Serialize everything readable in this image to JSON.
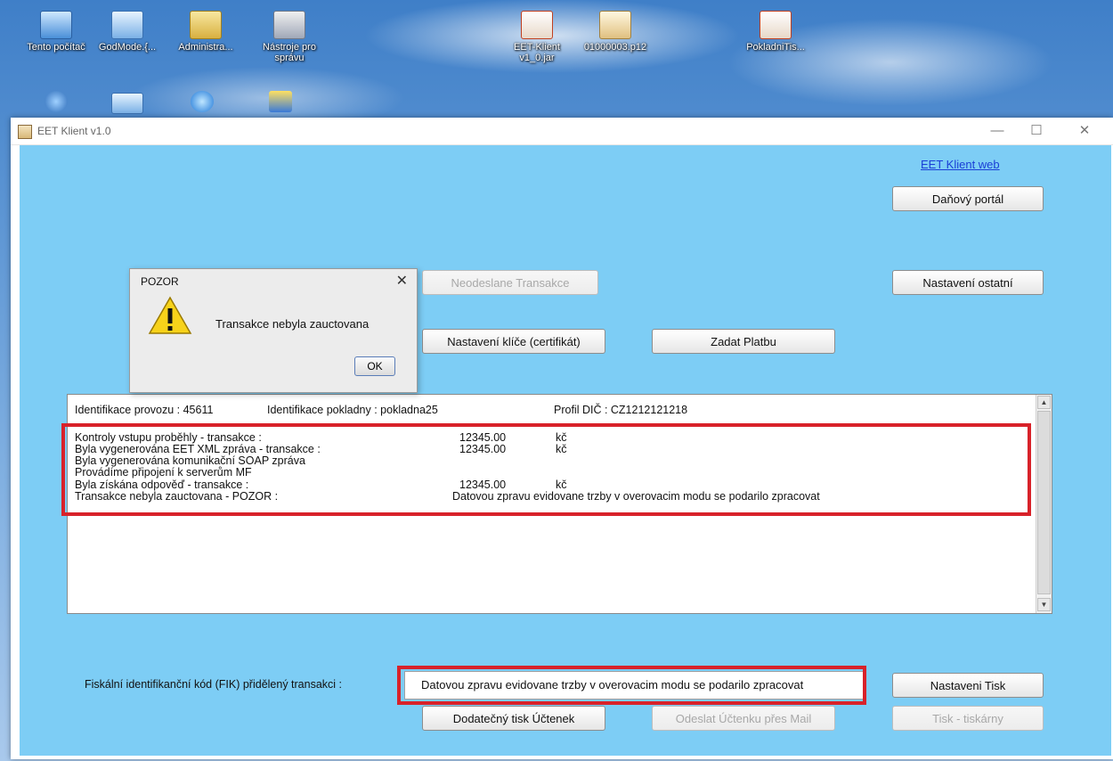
{
  "desktop": {
    "icons": [
      {
        "label": "Tento počítač"
      },
      {
        "label": "GodMode.{..."
      },
      {
        "label": "Administra..."
      },
      {
        "label": "Nástroje pro správu"
      },
      {
        "label": "EET-Klient v1_0.jar"
      },
      {
        "label": "01000003.p12"
      },
      {
        "label": "PokladniTis..."
      }
    ]
  },
  "window": {
    "title": "EET Klient v1.0",
    "minimize": "—",
    "maximize": "☐",
    "close": "✕"
  },
  "top": {
    "web_link": "EET Klient web",
    "danovy_portal": "Daňový portál",
    "nastaveni_ostatni": "Nastavení ostatní"
  },
  "middle": {
    "neodeslane": "Neodeslane Transakce",
    "nastaveni_klice": "Nastavení klíče (certifikát)",
    "zadat_platbu": "Zadat Platbu"
  },
  "log": {
    "header": {
      "provoz": "Identifikace provozu : 45611",
      "pokladna": "Identifikace pokladny : pokladna25",
      "dic": "Profil DIČ : CZ1212121218"
    },
    "rows": [
      {
        "label": "Kontroly vstupu proběhly - transakce :",
        "value": "12345.00",
        "unit": "kč"
      },
      {
        "label": "Byla vygenerována EET XML zpráva - transakce :",
        "value": "12345.00",
        "unit": "kč"
      },
      {
        "label": "Byla vygenerována komunikační SOAP zpráva",
        "value": "",
        "unit": ""
      },
      {
        "label": "Provádíme připojení k serverům MF",
        "value": "",
        "unit": ""
      },
      {
        "label": "Byla získána odpověď - transakce :",
        "value": "12345.00",
        "unit": "kč"
      },
      {
        "label": "Transakce nebyla zauctovana - POZOR :",
        "value": "Datovou zpravu evidovane trzby v overovacim modu se podarilo zpracovat",
        "unit": ""
      }
    ]
  },
  "bottom": {
    "fik_label": "Fiskální identifikanční kód (FIK) přidělený transakci :",
    "fik_value": "Datovou zpravu evidovane trzby v overovacim modu se podarilo zpracovat",
    "nastaveni_tisk": "Nastaveni Tisk",
    "dodatecny_tisk": "Dodatečný tisk Účtenek",
    "odeslat_mail": "Odeslat Účtenku přes Mail",
    "tisk_tiskarny": "Tisk - tiskárny"
  },
  "dialog": {
    "title": "POZOR",
    "close": "✕",
    "message": "Transakce nebyla zauctovana",
    "ok": "OK"
  },
  "colors": {
    "client_bg": "#7dcdf5",
    "highlight": "#d8222a",
    "link": "#1a3fd6"
  }
}
